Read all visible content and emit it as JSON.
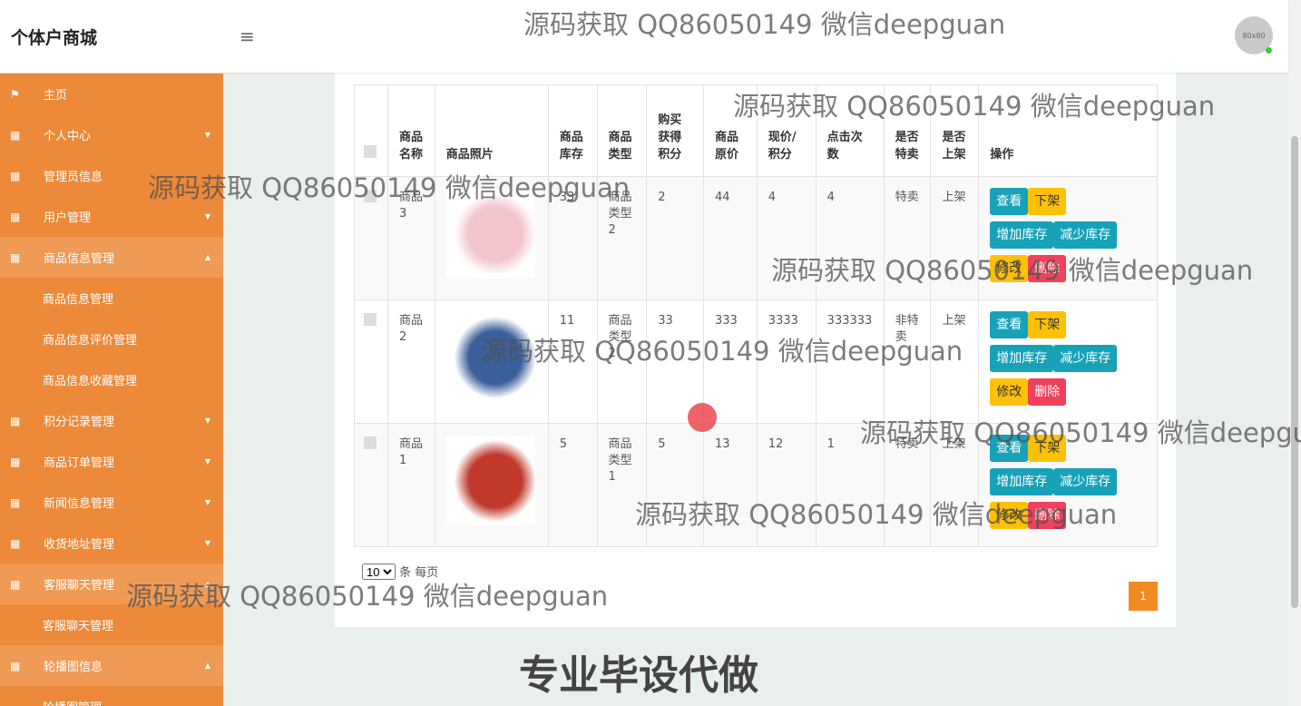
{
  "header": {
    "brand": "个体户商城",
    "avatar_text": "80x80"
  },
  "sidebar": [
    {
      "label": "主页",
      "icon": "flag-icon",
      "caret": ""
    },
    {
      "label": "个人中心",
      "icon": "grid-icon",
      "caret": "▼"
    },
    {
      "label": "管理员信息",
      "icon": "grid-icon",
      "caret": ""
    },
    {
      "label": "用户管理",
      "icon": "grid-icon",
      "caret": "▼"
    },
    {
      "label": "商品信息管理",
      "icon": "grid-icon",
      "caret": "▲",
      "active": true
    },
    {
      "label": "商品信息管理",
      "sub": true
    },
    {
      "label": "商品信息评价管理",
      "sub": true
    },
    {
      "label": "商品信息收藏管理",
      "sub": true
    },
    {
      "label": "积分记录管理",
      "icon": "grid-icon",
      "caret": "▼"
    },
    {
      "label": "商品订单管理",
      "icon": "grid-icon",
      "caret": "▼"
    },
    {
      "label": "新闻信息管理",
      "icon": "grid-icon",
      "caret": "▼"
    },
    {
      "label": "收货地址管理",
      "icon": "grid-icon",
      "caret": "▼"
    },
    {
      "label": "客服聊天管理",
      "icon": "grid-icon",
      "caret": "▲",
      "active": true
    },
    {
      "label": "客服聊天管理",
      "sub": true
    },
    {
      "label": "轮播图信息",
      "icon": "grid-icon",
      "caret": "▲",
      "active": true
    },
    {
      "label": "轮播图管理",
      "sub": true
    }
  ],
  "table": {
    "headers": [
      "商品名称",
      "商品照片",
      "商品库存",
      "商品类型",
      "购买获得积分",
      "商品原价",
      "现价/积分",
      "点击次数",
      "是否特卖",
      "是否上架",
      "操作"
    ],
    "rows": [
      {
        "name": "商品3",
        "stock": "33",
        "type": "商品类型2",
        "points": "2",
        "orig": "44",
        "price": "4",
        "clicks": "4",
        "special": "特卖",
        "onsale": "上架",
        "img": "#f2c4cc"
      },
      {
        "name": "商品2",
        "stock": "11",
        "type": "商品类型2",
        "points": "33",
        "orig": "333",
        "price": "3333",
        "clicks": "333333",
        "special": "非特卖",
        "onsale": "上架",
        "img": "#3a5f9a"
      },
      {
        "name": "商品1",
        "stock": "5",
        "type": "商品类型1",
        "points": "5",
        "orig": "13",
        "price": "12",
        "clicks": "1",
        "special": "特卖",
        "onsale": "上架",
        "img": "#c0392b"
      }
    ],
    "buttons": {
      "view": "查看",
      "offshelf": "下架",
      "add_stock": "增加库存",
      "reduce_stock": "减少库存",
      "edit": "修改",
      "delete": "删除"
    }
  },
  "pagination": {
    "page_size": "10",
    "per_page_label": "条 每页",
    "current_page": "1"
  },
  "watermark": "源码获取 QQ86050149 微信deepguan",
  "banner": "专业毕设代做"
}
